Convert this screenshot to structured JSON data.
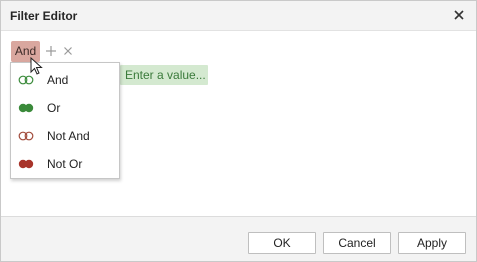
{
  "window": {
    "title": "Filter Editor"
  },
  "toolbar": {
    "group_operator": "And"
  },
  "condition": {
    "value_placeholder": "Enter a value..."
  },
  "operator_menu": {
    "items": [
      {
        "label": "And",
        "icon": "and-icon",
        "fill": "none",
        "color": "#3a8a3a"
      },
      {
        "label": "Or",
        "icon": "or-icon",
        "fill": "solid",
        "color": "#3a8a3a"
      },
      {
        "label": "Not And",
        "icon": "not-and-icon",
        "fill": "none",
        "color": "#a14a3a"
      },
      {
        "label": "Not Or",
        "icon": "not-or-icon",
        "fill": "solid",
        "color": "#a8342a"
      }
    ]
  },
  "footer": {
    "ok_label": "OK",
    "cancel_label": "Cancel",
    "apply_label": "Apply"
  },
  "colors": {
    "group_button_bg": "#d9a79f",
    "value_editor_bg": "#d4e9d0",
    "value_editor_text": "#3a7a3a",
    "title_bar": "#f3f3f3"
  }
}
